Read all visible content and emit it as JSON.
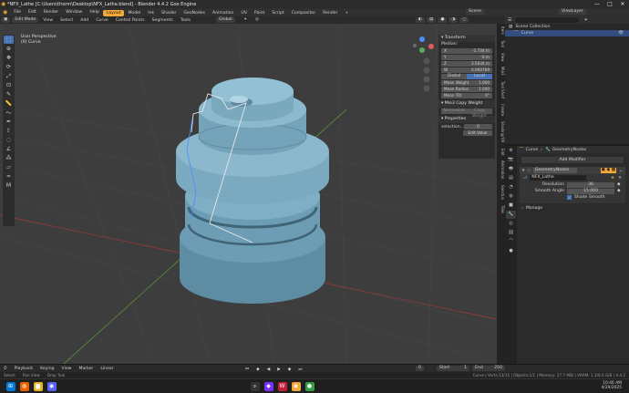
{
  "window": {
    "title": "*NFX_Lathe [C:\\Users\\thorm\\Desktop\\NFX_Lathe.blend] - Blender 4.4.2 Goo Engine",
    "min": "—",
    "max": "□",
    "close": "✕"
  },
  "menu": {
    "items": [
      "File",
      "Edit",
      "Render",
      "Window",
      "Help"
    ],
    "workspaces": [
      "Layout",
      "Model",
      "Ink",
      "Shader",
      "GeoNodes",
      "Animation",
      "UV",
      "Paint",
      "Script",
      "Compositor",
      "Render"
    ],
    "scene_label": "Scene",
    "viewlayer_label": "ViewLayer"
  },
  "viewport_header": {
    "mode": "Edit Mode",
    "menus": [
      "View",
      "Select",
      "Add",
      "Curve",
      "Control Points",
      "Segments",
      "Tools"
    ],
    "orientation": "Global"
  },
  "viewport": {
    "line1": "User Perspective",
    "line2": "(0) Curve"
  },
  "npanel": {
    "transform_title": "Transform",
    "median_label": "Median:",
    "fields": [
      {
        "k": "X",
        "v": "-1.734 m"
      },
      {
        "k": "Y",
        "v": "-0 m"
      },
      {
        "k": "Z",
        "v": "3.5834 m"
      },
      {
        "k": "W",
        "v": "0.000769"
      }
    ],
    "global_label": "Global",
    "local_label": "Local",
    "mean": [
      {
        "k": "Mean Weight",
        "v": "1.000"
      },
      {
        "k": "Mean Radius",
        "v": "1.000"
      },
      {
        "k": "Mean Tilt",
        "v": "0°"
      }
    ],
    "mio3_title": "Mio3 Copy Weight",
    "normalize": "Normalize",
    "copy_weight": "Copy Weight",
    "properties_title": "Properties",
    "prop_key": "selection…",
    "prop_val": "0",
    "edit_label": "Edit Value",
    "edit_btn": "Edit Value"
  },
  "sidetabs": [
    "Item",
    "Tool",
    "View",
    "Mio3",
    "Tool Shelf",
    "Create",
    "Shading/UV",
    "Edit",
    "Animation",
    "Sanctus",
    "Tiles",
    "Lathe",
    "MiraTools",
    "Display",
    "Save",
    "Misc"
  ],
  "outliner": {
    "search_placeholder": "",
    "collection": "Scene Collection",
    "object": "Curve"
  },
  "properties": {
    "breadcrumb_obj": "Curve",
    "breadcrumb_mod": "GeometryNodes",
    "add_modifier": "Add Modifier",
    "mod_name": "GeometryNodes",
    "node_group": "NFX_Lathe",
    "resolution_label": "Resolution",
    "resolution": "36",
    "smooth_angle_label": "Smooth Angle",
    "smooth_angle": "15.000",
    "shade_smooth": "Shade Smooth",
    "manage": "Manage"
  },
  "timeline": {
    "playback": "Playback",
    "keying": "Keying",
    "view": "View",
    "marker": "Marker",
    "interp": "Linear",
    "start_label": "Start",
    "start": "1",
    "end_label": "End",
    "end": "250",
    "frame": "0"
  },
  "status": {
    "left": [
      "Select",
      "Pan View",
      "Drop Tool"
    ],
    "right": "Curve | Verts:13/15 | Objects:1/1 | Memory: 27.7 MiB | VRAM: 1.1/8.0 GiB | 4.4.2"
  },
  "taskbar": {
    "time": "10:46 AM",
    "date": "4/29/2025"
  },
  "colors": {
    "accent": "#f4a83a",
    "select": "#4772b3",
    "bg": "#3d3d3d",
    "model": "#7fa9be"
  }
}
